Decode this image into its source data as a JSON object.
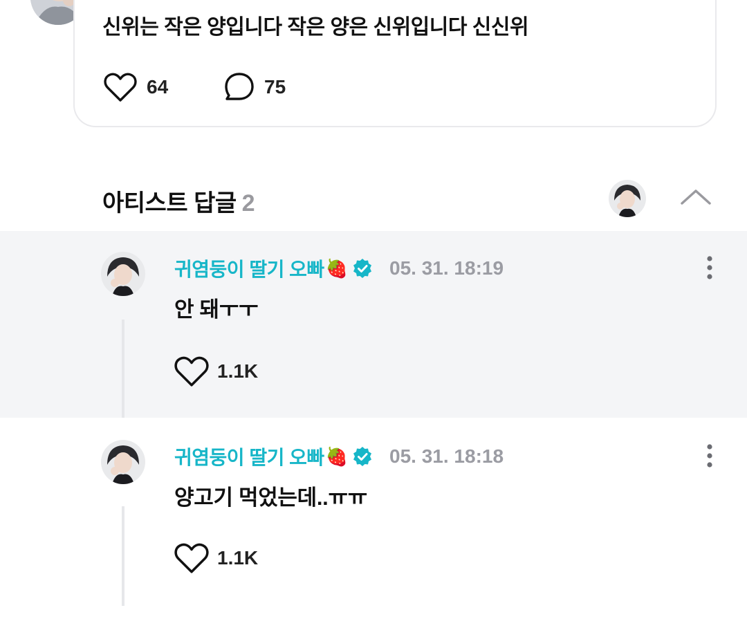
{
  "post": {
    "text": "신위는 작은 양입니다 작은 양은 신위입니다 신신위",
    "likes": "64",
    "comments": "75"
  },
  "section": {
    "title": "아티스트 답글",
    "count": "2"
  },
  "replies": [
    {
      "author": "귀염둥이 딸기 오빠",
      "author_emoji": "🍓",
      "timestamp": "05. 31. 18:19",
      "text": "안 돼ㅜㅜ",
      "likes": "1.1K",
      "highlighted": true
    },
    {
      "author": "귀염둥이 딸기 오빠",
      "author_emoji": "🍓",
      "timestamp": "05. 31. 18:18",
      "text": "양고기 먹었는데..ㅠㅠ",
      "likes": "1.1K",
      "highlighted": false
    }
  ],
  "colors": {
    "accent": "#17b6c8",
    "verified_badge": "#17b6c8",
    "muted_text": "#9b9ca3",
    "highlight_bg": "#f4f5f7"
  },
  "icons": {
    "like": "heart-icon",
    "comment": "speech-bubble-icon",
    "verified": "verified-badge-icon",
    "collapse": "chevron-up-icon",
    "more": "vertical-dots-icon"
  }
}
